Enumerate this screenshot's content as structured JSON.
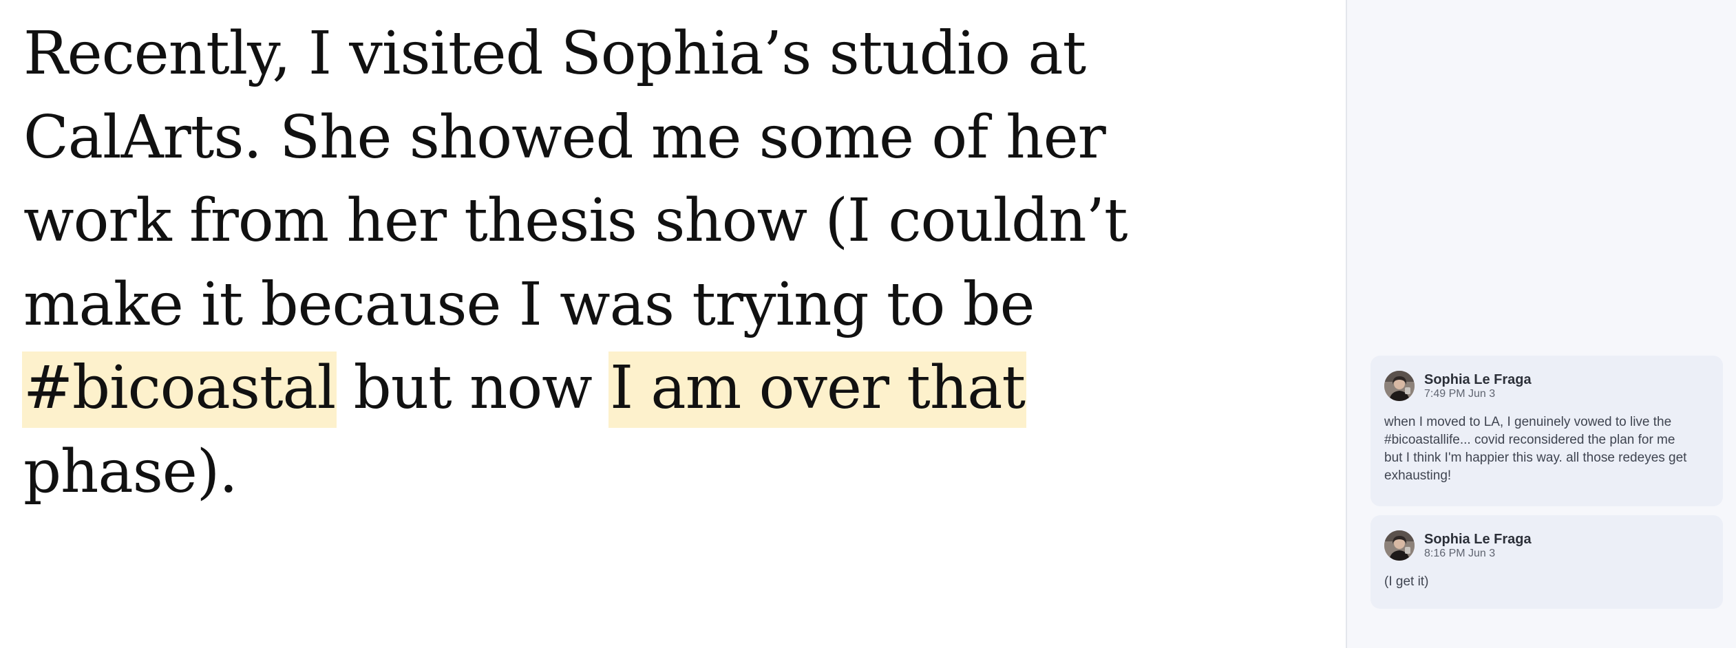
{
  "document": {
    "paragraph": {
      "text_before": "Recently, I visited Sophia’s studio at CalArts. She showed me some of her work from her thesis show (I couldn’t make it because I was trying to be ",
      "highlight_1": "#bicoastal",
      "text_between": " but now ",
      "highlight_2": "I am over that",
      "text_after": " phase)."
    }
  },
  "colors": {
    "highlight": "#fdf1cc",
    "comment_background": "#eceff7",
    "sidebar_background": "#f6f7fb"
  },
  "comments": [
    {
      "author": "Sophia Le Fraga",
      "time": "7:49 PM Jun 3",
      "body": "when I moved to LA, I genuinely vowed to live the #bicoastallife... covid reconsidered the plan for me but I think I'm happier this way. all those redeyes get exhausting!",
      "avatar_icon": "user-avatar"
    },
    {
      "author": "Sophia Le Fraga",
      "time": "8:16 PM Jun 3",
      "body": "(I get it)",
      "avatar_icon": "user-avatar"
    }
  ]
}
